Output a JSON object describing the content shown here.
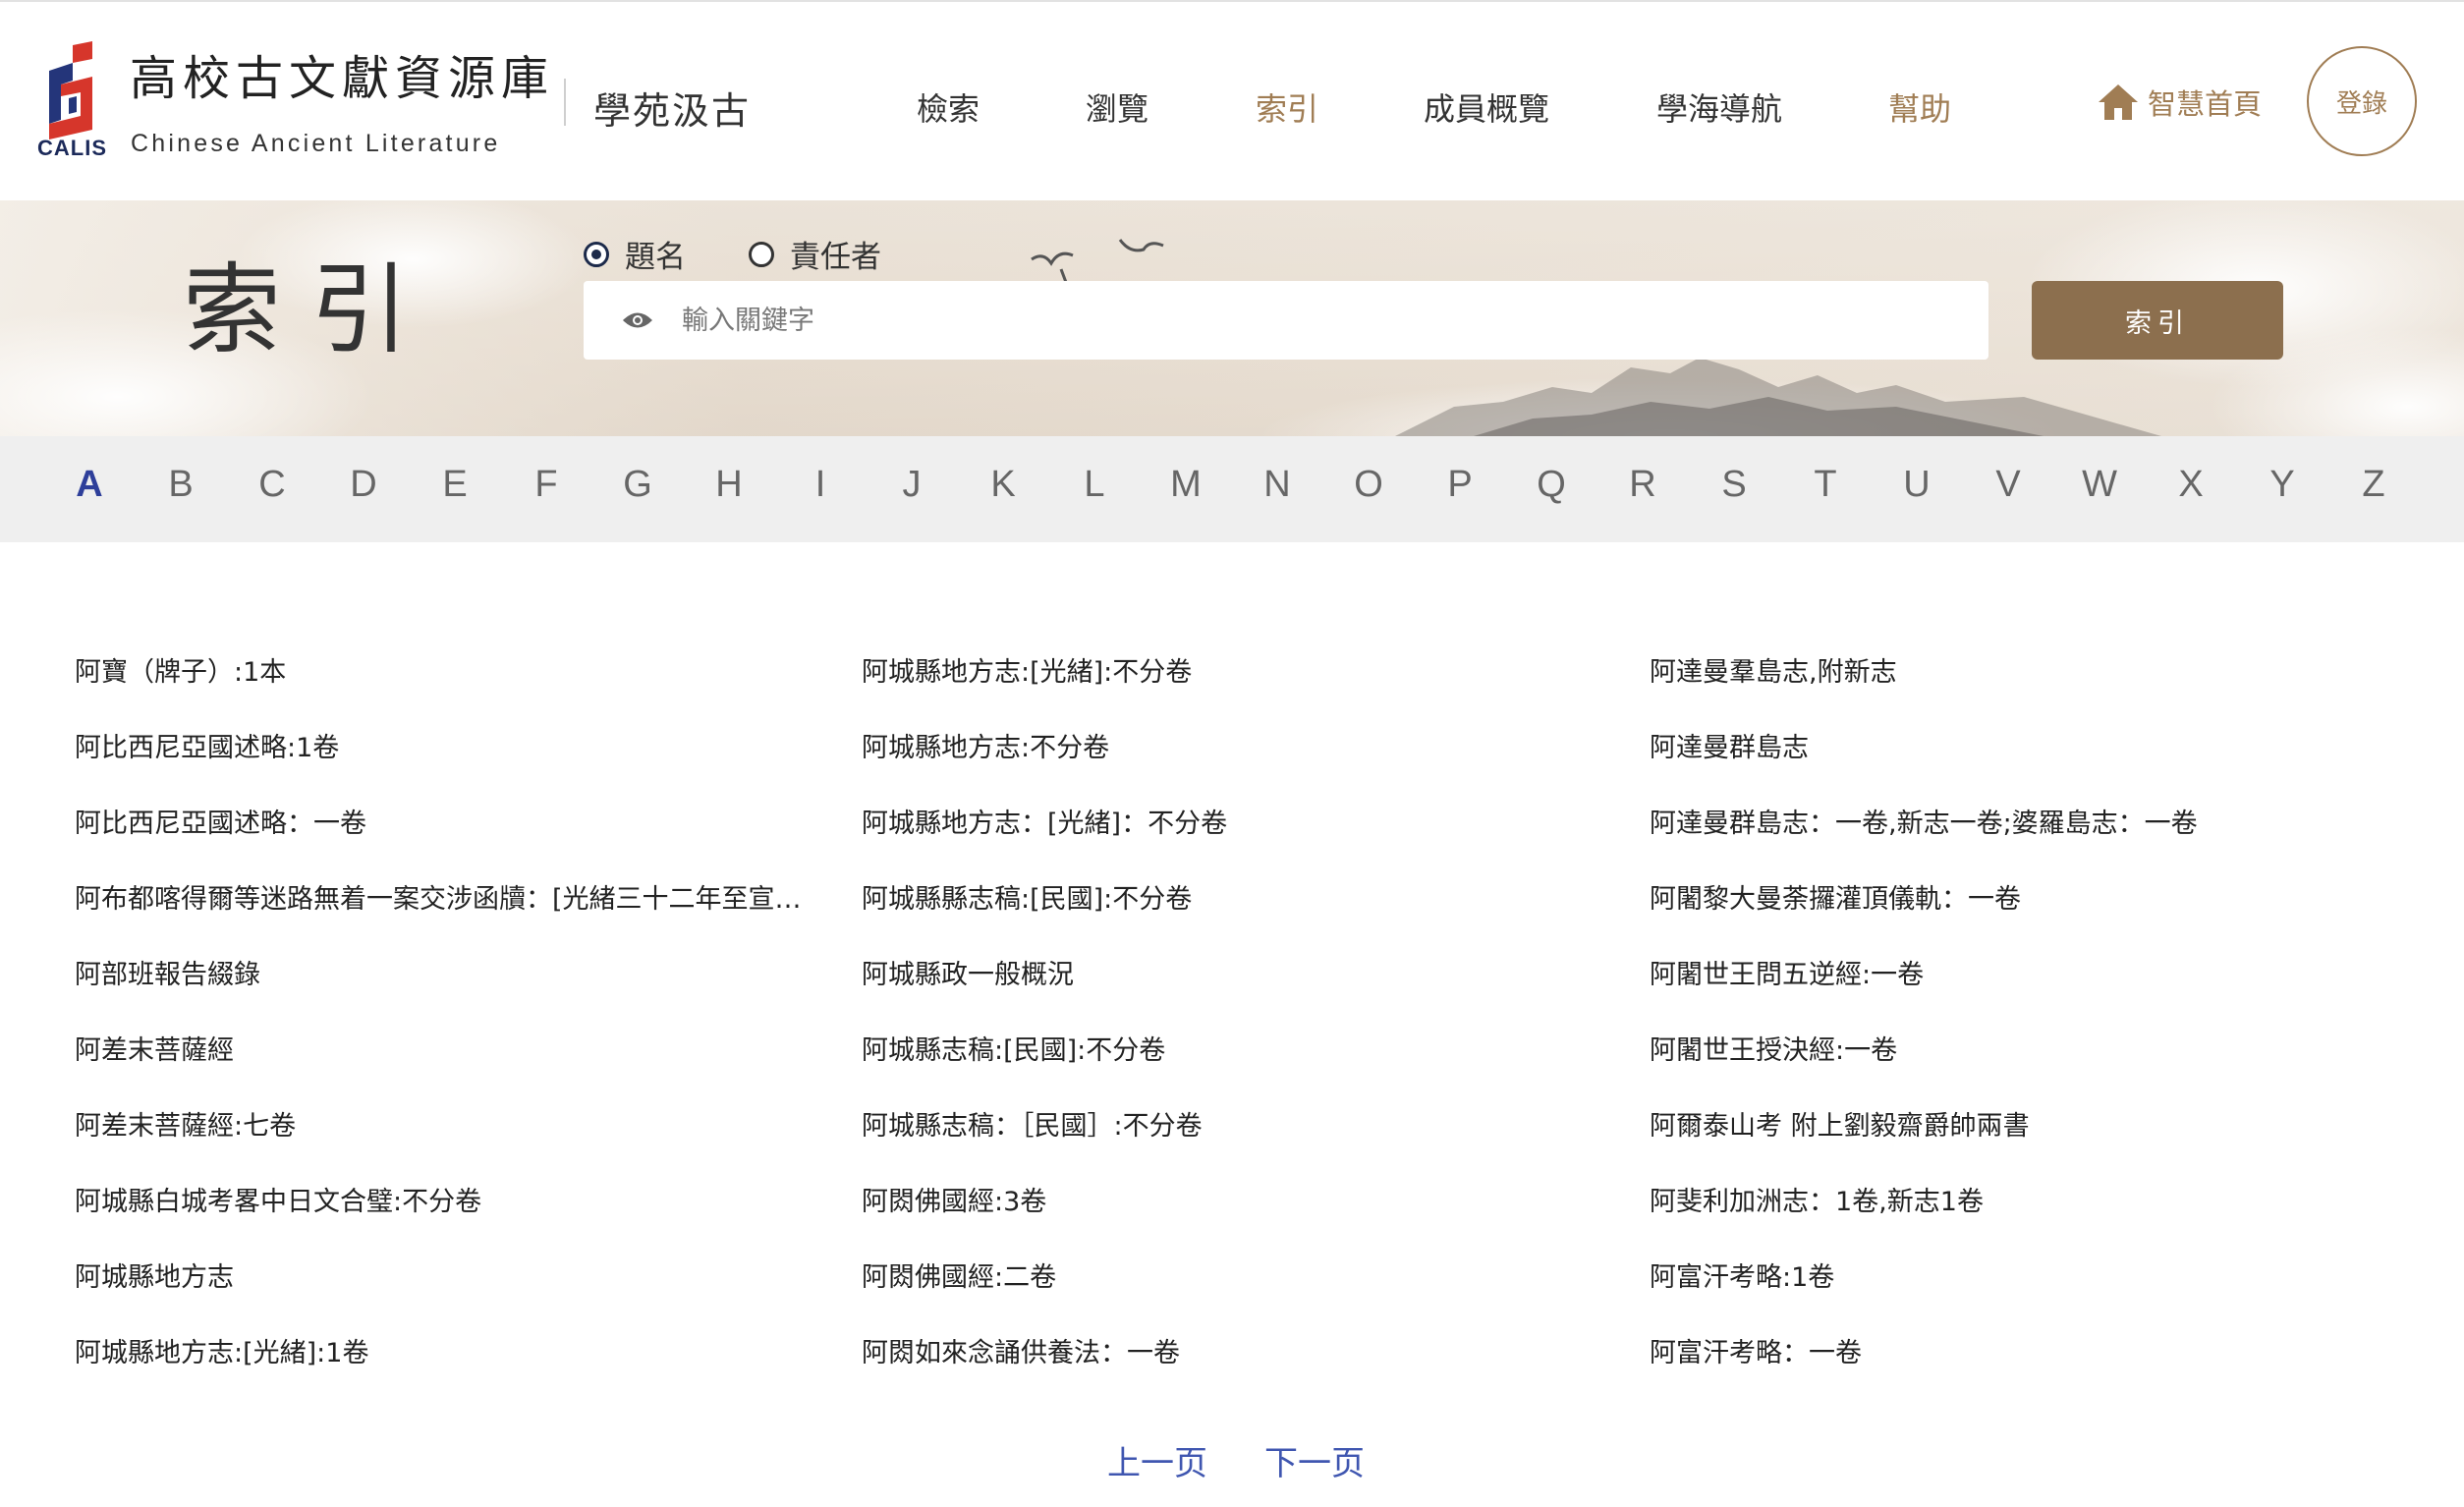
{
  "header": {
    "site_title": "高校古文獻資源庫",
    "site_subtitle": "Chinese Ancient Literature",
    "logo_text": "CALIS",
    "sub_brand": "學苑汲古",
    "nav": [
      {
        "label": "檢索",
        "active": false
      },
      {
        "label": "瀏覽",
        "active": false
      },
      {
        "label": "索引",
        "active": true
      },
      {
        "label": "成員概覽",
        "active": false
      },
      {
        "label": "學海導航",
        "active": false
      },
      {
        "label": "幫助",
        "active": true
      }
    ],
    "home_label": "智慧首頁",
    "login_label": "登錄"
  },
  "banner": {
    "title": "索引",
    "radio_title": "題名",
    "radio_author": "責任者",
    "selected": "題名",
    "search_placeholder": "輸入關鍵字",
    "search_button": "索引"
  },
  "alphabet": {
    "letters": [
      "A",
      "B",
      "C",
      "D",
      "E",
      "F",
      "G",
      "H",
      "I",
      "J",
      "K",
      "L",
      "M",
      "N",
      "O",
      "P",
      "Q",
      "R",
      "S",
      "T",
      "U",
      "V",
      "W",
      "X",
      "Y",
      "Z"
    ],
    "active": "A"
  },
  "results": {
    "col1": [
      "阿寶（牌子）:1本",
      "阿比西尼亞國述略:1卷",
      "阿比西尼亞國述略：一卷",
      "阿布都喀得爾等迷路無着一案交涉函牘：[光緒三十二年至宣統元年]",
      "阿部班報告綴錄",
      "阿差末菩薩經",
      "阿差末菩薩經:七卷",
      "阿城縣白城考畧中日文合璧:不分卷",
      "阿城縣地方志",
      "阿城縣地方志:[光緒]:1卷"
    ],
    "col2": [
      "阿城縣地方志:[光緒]:不分卷",
      "阿城縣地方志:不分卷",
      "阿城縣地方志：[光緒]：不分卷",
      "阿城縣縣志稿:[民國]:不分卷",
      "阿城縣政一般概況",
      "阿城縣志稿:[民國]:不分卷",
      "阿城縣志稿：［民國］:不分卷",
      "阿閦佛國經:3卷",
      "阿閦佛國經:二卷",
      "阿閦如來念誦供養法：一卷"
    ],
    "col3": [
      "阿達曼羣島志,附新志",
      "阿達曼群島志",
      "阿達曼群島志：一卷,新志一卷;婆羅島志：一卷",
      "阿闍黎大曼荼攞灌頂儀軌：一卷",
      "阿闍世王問五逆經:一卷",
      "阿闍世王授決經:一卷",
      "阿爾泰山考 附上劉毅齋爵帥兩書",
      "阿斐利加洲志：1卷,新志1卷",
      "阿富汗考略:1卷",
      "阿富汗考略：一卷"
    ]
  },
  "pager": {
    "prev": "上一页",
    "next": "下一页"
  },
  "colors": {
    "accent": "#a07d54",
    "search_button": "#8c6f4e",
    "active_letter": "#2e3f9a",
    "pager_link": "#3f56b0",
    "logo_red": "#d6362b",
    "logo_blue": "#24357a"
  }
}
